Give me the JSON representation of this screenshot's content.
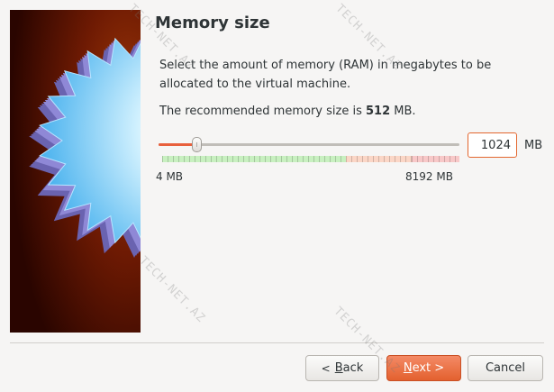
{
  "page": {
    "title": "Memory size"
  },
  "content": {
    "description": "Select the amount of memory (RAM) in megabytes to be allocated to the virtual machine.",
    "recommended_prefix": "The recommended memory size is",
    "recommended_value": "512",
    "recommended_unit": "MB."
  },
  "memory": {
    "value": "1024",
    "unit": "MB",
    "slider_fraction": 0.125,
    "range_min_label": "4 MB",
    "range_max_label": "8192 MB",
    "scale_green_fraction": 0.62,
    "scale_orange_fraction": 0.22,
    "scale_red_fraction": 0.16
  },
  "buttons": {
    "back_label": "Back",
    "back_mnemonic": "B",
    "back_rest": "ack",
    "next_label": "Next >",
    "next_mnemonic": "N",
    "next_rest": "ext >",
    "cancel_label": "Cancel"
  },
  "icons": {
    "back": "chevron-left-icon"
  },
  "colors": {
    "accent": "#e3612f",
    "slider_fill": "#e8603c",
    "scale_green": "#c8f0c0",
    "scale_orange": "#fbd6c6",
    "scale_red": "#f8c8c8",
    "side_dark": "#3d0a02",
    "side_mid": "#8a2a06"
  },
  "watermark": {
    "text": "TECH-NET.AZ"
  }
}
